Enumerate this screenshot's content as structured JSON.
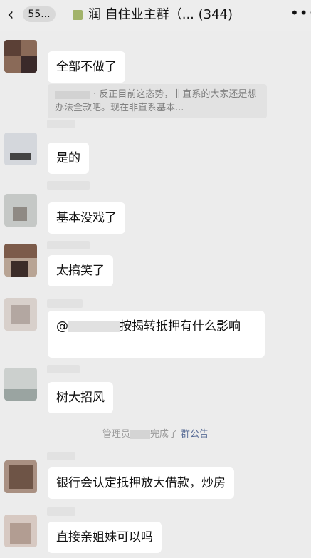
{
  "header": {
    "back_icon": "chevron-left-icon",
    "unread_badge": "55...",
    "title": "润 自住业主群（...",
    "member_count": "(344)",
    "more_icon": "more-dots-icon"
  },
  "messages": [
    {
      "text": "全部不做了"
    },
    {
      "quote": "· 反正目前这态势，非直系的大家还是想办法全款吧。现在非直系基本..."
    },
    {
      "text": "是的"
    },
    {
      "text": "基本没戏了"
    },
    {
      "text": "太搞笑了"
    },
    {
      "mention": "@",
      "text": "按揭转抵押有什么影响"
    },
    {
      "text": "树大招风"
    },
    {
      "text": "银行会认定抵押放大借款，炒房"
    },
    {
      "text": "直接亲姐妹可以吗"
    }
  ],
  "system_notice": {
    "prefix": "管理员",
    "middle": "完成了",
    "link": "群公告"
  }
}
